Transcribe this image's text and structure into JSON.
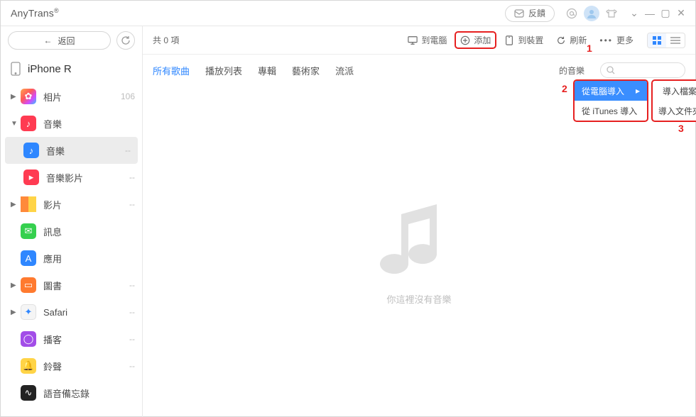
{
  "app": {
    "name": "AnyTrans",
    "reg": "®"
  },
  "titlebar": {
    "feedback": "反饋"
  },
  "sidebar": {
    "back": "返回",
    "device": "iPhone R",
    "items": [
      {
        "label": "相片",
        "count": "106"
      },
      {
        "label": "音樂",
        "count": ""
      },
      {
        "label": "音樂",
        "count": "--",
        "sub": true,
        "selected": true
      },
      {
        "label": "音樂影片",
        "count": "--",
        "sub": true
      },
      {
        "label": "影片",
        "count": "--"
      },
      {
        "label": "訊息",
        "count": ""
      },
      {
        "label": "應用",
        "count": ""
      },
      {
        "label": "圖書",
        "count": "--"
      },
      {
        "label": "Safari",
        "count": "--"
      },
      {
        "label": "播客",
        "count": "--"
      },
      {
        "label": "鈴聲",
        "count": "--"
      },
      {
        "label": "語音備忘錄",
        "count": ""
      }
    ]
  },
  "toolbar": {
    "count": "共 0 項",
    "to_computer": "到電腦",
    "add": "添加",
    "to_device": "到裝置",
    "refresh": "刷新",
    "more": "更多"
  },
  "tabs": {
    "all_songs": "所有歌曲",
    "playlists": "播放列表",
    "albums": "專輯",
    "artists": "藝術家",
    "genres": "流派",
    "right_label": "的音樂"
  },
  "menu1": {
    "from_computer": "從電腦導入",
    "from_itunes": "從 iTunes 導入"
  },
  "menu2": {
    "import_file": "導入檔案",
    "import_folder": "導入文件夾"
  },
  "annotations": {
    "a1": "1",
    "a2": "2",
    "a3": "3"
  },
  "empty": {
    "msg": "你這裡沒有音樂"
  }
}
